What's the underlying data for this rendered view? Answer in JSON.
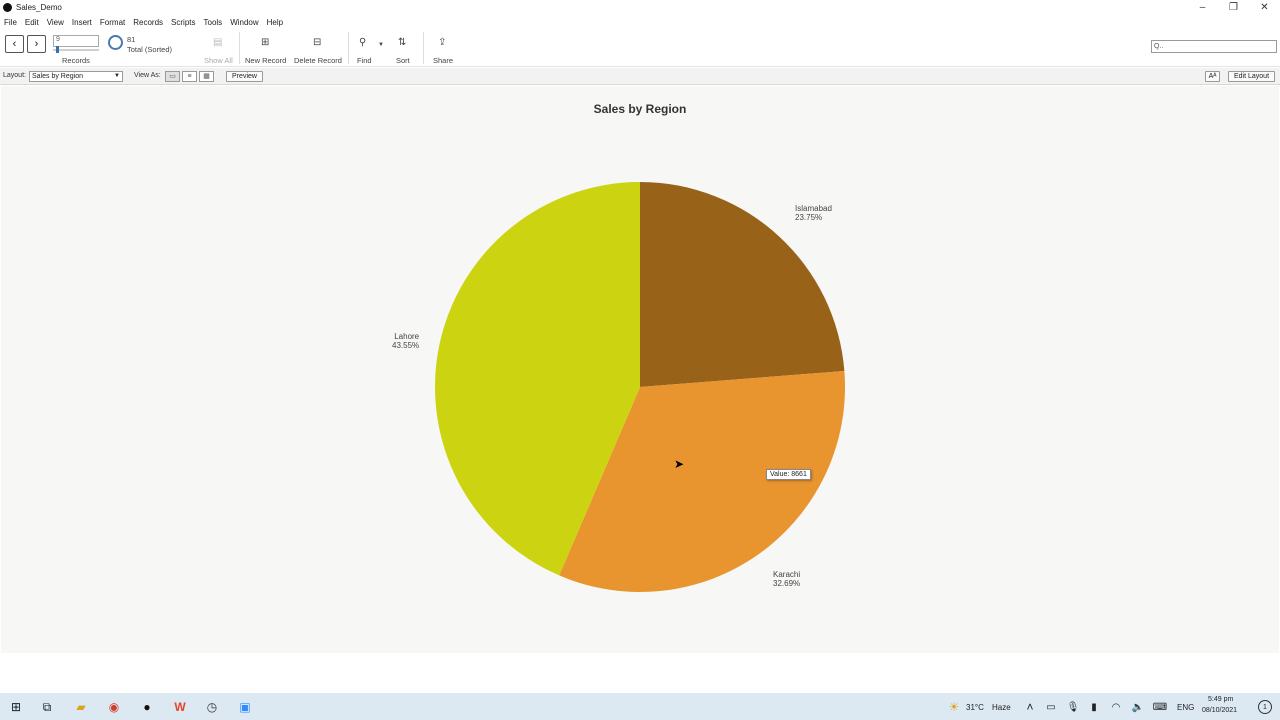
{
  "window": {
    "title": "Sales_Demo",
    "minimize": "–",
    "maximize": "❐",
    "close": "✕"
  },
  "menu": [
    "File",
    "Edit",
    "View",
    "Insert",
    "Format",
    "Records",
    "Scripts",
    "Tools",
    "Window",
    "Help"
  ],
  "toolbar": {
    "prev_glyph": "‹",
    "next_glyph": "›",
    "record_number": "9",
    "records_label": "Records",
    "total_count": "81",
    "total_label": "Total (Sorted)",
    "show_all": "Show All",
    "new_record": "New Record",
    "delete_record": "Delete Record",
    "find": "Find",
    "sort": "Sort",
    "share": "Share",
    "search_placeholder": "Q.."
  },
  "layout_bar": {
    "layout_label": "Layout:",
    "layout_value": "Sales by Region",
    "view_as_label": "View As:",
    "preview": "Preview",
    "aa": "Aᴬ",
    "edit_layout": "Edit Layout"
  },
  "chart_data": {
    "type": "pie",
    "title": "Sales by Region",
    "slices": [
      {
        "label": "Islamabad",
        "percent": 23.75,
        "pct_text": "23.75%",
        "color": "#986319"
      },
      {
        "label": "Karachi",
        "percent": 32.69,
        "pct_text": "32.69%",
        "color": "#e9952f"
      },
      {
        "label": "Lahore",
        "percent": 43.55,
        "pct_text": "43.55%",
        "color": "#ccd412"
      }
    ],
    "tooltip": "Value: 8661"
  },
  "taskbar": {
    "weather_temp": "31°C",
    "weather_desc": "Haze",
    "language": "ENG",
    "time": "5:49 pm",
    "date": "08/10/2021",
    "notification_count": "1"
  }
}
